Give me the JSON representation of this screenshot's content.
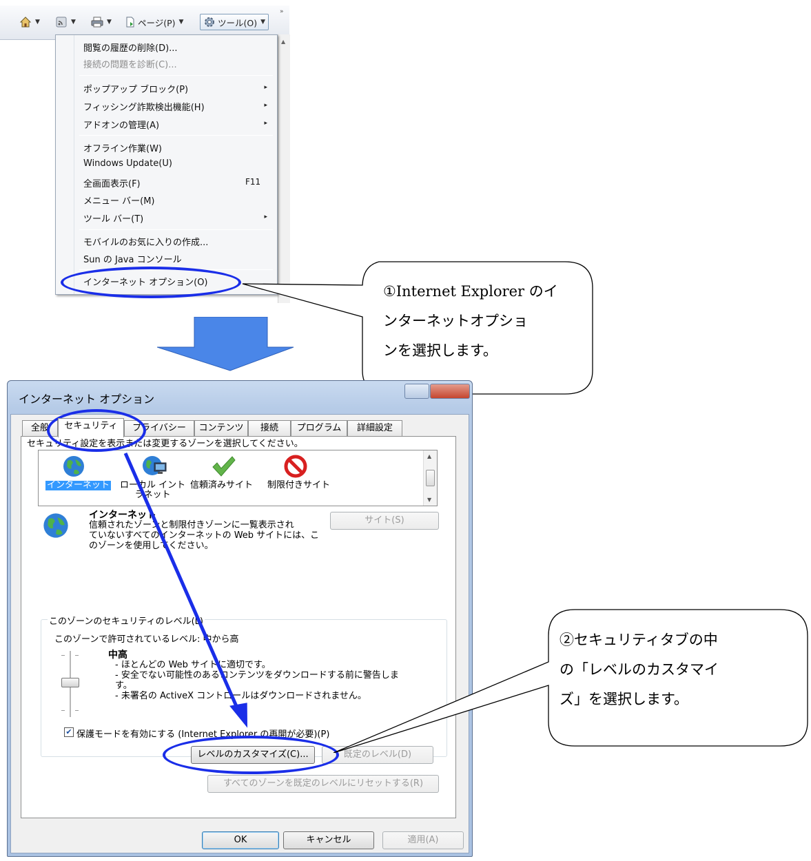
{
  "toolbar": {
    "home_caret": "▼",
    "feeds_caret": "▼",
    "print_caret": "▼",
    "page_label": "ページ(P)",
    "page_caret": "▼",
    "tools_label": "ツール(O)",
    "tools_caret": "▼",
    "more": "»"
  },
  "tools_menu": {
    "items": [
      {
        "label": "閲覧の履歴の削除(D)..."
      },
      {
        "label": "接続の問題を診断(C)..."
      },
      {
        "label": "ポップアップ ブロック(P)",
        "arrow": "▸"
      },
      {
        "label": "フィッシング詐欺検出機能(H)",
        "arrow": "▸"
      },
      {
        "label": "アドオンの管理(A)",
        "arrow": "▸"
      },
      {
        "label": "オフライン作業(W)"
      },
      {
        "label": "Windows Update(U)"
      },
      {
        "label": "全画面表示(F)",
        "shortcut": "F11"
      },
      {
        "label": "メニュー バー(M)"
      },
      {
        "label": "ツール バー(T)",
        "arrow": "▸"
      },
      {
        "label": "モバイルのお気に入りの作成..."
      },
      {
        "label": "Sun の Java コンソール"
      },
      {
        "label": "インターネット オプション(O)"
      }
    ]
  },
  "callouts": {
    "step1": [
      "①Internet Explorer のイ",
      "ンターネットオプショ",
      "ンを選択します。"
    ],
    "step2": [
      "②セキュリティタブの中",
      "の「レベルのカスタマイ",
      "ズ」を選択します。"
    ]
  },
  "dialog": {
    "title": "インターネット オプション",
    "tabs": [
      "全般",
      "セキュリティ",
      "プライバシー",
      "コンテンツ",
      "接続",
      "プログラム",
      "詳細設定"
    ],
    "zone_prompt": "セキュリティ設定を表示または変更するゾーンを選択してください。",
    "zones": [
      {
        "label": "インターネット",
        "icon": "globe-icon"
      },
      {
        "label": "ローカル イント",
        "label2": "ラネット",
        "icon": "intranet-icon"
      },
      {
        "label": "信頼済みサイト",
        "icon": "checkmark-icon"
      },
      {
        "label": "制限付きサイト",
        "icon": "prohibited-icon"
      }
    ],
    "zone_name": "インターネット",
    "zone_desc": [
      "信頼されたゾーンと制限付きゾーンに一覧表示され",
      "ていないすべてのインターネットの Web サイトには、こ",
      "のゾーンを使用してください。"
    ],
    "sites_button": "サイト(S)",
    "security_level_group": "このゾーンのセキュリティのレベル(L)",
    "allowed_levels": "このゾーンで許可されているレベル: 中から高",
    "level_name": "中高",
    "level_desc": [
      "- ほとんどの Web サイトに適切です。",
      "- 安全でない可能性のあるコンテンツをダウンロードする前に警告しま",
      "す。",
      "- 未署名の ActiveX コントロールはダウンロードされません。"
    ],
    "protected_mode": "保護モードを有効にする (Internet Explorer の再開が必要)(P)",
    "protected_mode_checked": true,
    "customize_button": "レベルのカスタマイズ(C)...",
    "default_level_button": "既定のレベル(D)",
    "reset_all_button": "すべてのゾーンを既定のレベルにリセットする(R)",
    "ok_button": "OK",
    "cancel_button": "キャンセル",
    "apply_button": "適用(A)"
  },
  "colors": {
    "annotation_blue": "#1a2ee8",
    "arrow_fill": "#4a86e8",
    "selection": "#3399ff"
  }
}
